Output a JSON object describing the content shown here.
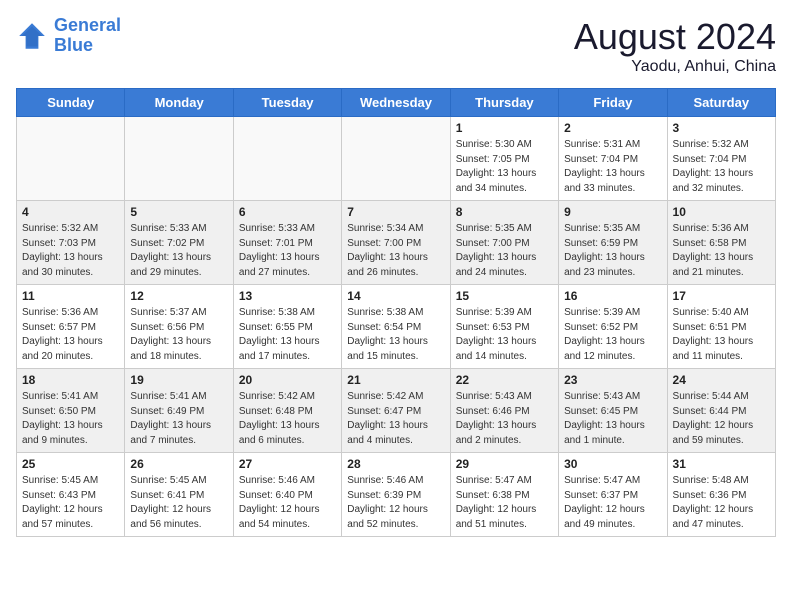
{
  "header": {
    "logo_line1": "General",
    "logo_line2": "Blue",
    "month_year": "August 2024",
    "location": "Yaodu, Anhui, China"
  },
  "weekdays": [
    "Sunday",
    "Monday",
    "Tuesday",
    "Wednesday",
    "Thursday",
    "Friday",
    "Saturday"
  ],
  "rows": [
    {
      "shaded": false,
      "days": [
        {
          "num": "",
          "info": ""
        },
        {
          "num": "",
          "info": ""
        },
        {
          "num": "",
          "info": ""
        },
        {
          "num": "",
          "info": ""
        },
        {
          "num": "1",
          "info": "Sunrise: 5:30 AM\nSunset: 7:05 PM\nDaylight: 13 hours\nand 34 minutes."
        },
        {
          "num": "2",
          "info": "Sunrise: 5:31 AM\nSunset: 7:04 PM\nDaylight: 13 hours\nand 33 minutes."
        },
        {
          "num": "3",
          "info": "Sunrise: 5:32 AM\nSunset: 7:04 PM\nDaylight: 13 hours\nand 32 minutes."
        }
      ]
    },
    {
      "shaded": true,
      "days": [
        {
          "num": "4",
          "info": "Sunrise: 5:32 AM\nSunset: 7:03 PM\nDaylight: 13 hours\nand 30 minutes."
        },
        {
          "num": "5",
          "info": "Sunrise: 5:33 AM\nSunset: 7:02 PM\nDaylight: 13 hours\nand 29 minutes."
        },
        {
          "num": "6",
          "info": "Sunrise: 5:33 AM\nSunset: 7:01 PM\nDaylight: 13 hours\nand 27 minutes."
        },
        {
          "num": "7",
          "info": "Sunrise: 5:34 AM\nSunset: 7:00 PM\nDaylight: 13 hours\nand 26 minutes."
        },
        {
          "num": "8",
          "info": "Sunrise: 5:35 AM\nSunset: 7:00 PM\nDaylight: 13 hours\nand 24 minutes."
        },
        {
          "num": "9",
          "info": "Sunrise: 5:35 AM\nSunset: 6:59 PM\nDaylight: 13 hours\nand 23 minutes."
        },
        {
          "num": "10",
          "info": "Sunrise: 5:36 AM\nSunset: 6:58 PM\nDaylight: 13 hours\nand 21 minutes."
        }
      ]
    },
    {
      "shaded": false,
      "days": [
        {
          "num": "11",
          "info": "Sunrise: 5:36 AM\nSunset: 6:57 PM\nDaylight: 13 hours\nand 20 minutes."
        },
        {
          "num": "12",
          "info": "Sunrise: 5:37 AM\nSunset: 6:56 PM\nDaylight: 13 hours\nand 18 minutes."
        },
        {
          "num": "13",
          "info": "Sunrise: 5:38 AM\nSunset: 6:55 PM\nDaylight: 13 hours\nand 17 minutes."
        },
        {
          "num": "14",
          "info": "Sunrise: 5:38 AM\nSunset: 6:54 PM\nDaylight: 13 hours\nand 15 minutes."
        },
        {
          "num": "15",
          "info": "Sunrise: 5:39 AM\nSunset: 6:53 PM\nDaylight: 13 hours\nand 14 minutes."
        },
        {
          "num": "16",
          "info": "Sunrise: 5:39 AM\nSunset: 6:52 PM\nDaylight: 13 hours\nand 12 minutes."
        },
        {
          "num": "17",
          "info": "Sunrise: 5:40 AM\nSunset: 6:51 PM\nDaylight: 13 hours\nand 11 minutes."
        }
      ]
    },
    {
      "shaded": true,
      "days": [
        {
          "num": "18",
          "info": "Sunrise: 5:41 AM\nSunset: 6:50 PM\nDaylight: 13 hours\nand 9 minutes."
        },
        {
          "num": "19",
          "info": "Sunrise: 5:41 AM\nSunset: 6:49 PM\nDaylight: 13 hours\nand 7 minutes."
        },
        {
          "num": "20",
          "info": "Sunrise: 5:42 AM\nSunset: 6:48 PM\nDaylight: 13 hours\nand 6 minutes."
        },
        {
          "num": "21",
          "info": "Sunrise: 5:42 AM\nSunset: 6:47 PM\nDaylight: 13 hours\nand 4 minutes."
        },
        {
          "num": "22",
          "info": "Sunrise: 5:43 AM\nSunset: 6:46 PM\nDaylight: 13 hours\nand 2 minutes."
        },
        {
          "num": "23",
          "info": "Sunrise: 5:43 AM\nSunset: 6:45 PM\nDaylight: 13 hours\nand 1 minute."
        },
        {
          "num": "24",
          "info": "Sunrise: 5:44 AM\nSunset: 6:44 PM\nDaylight: 12 hours\nand 59 minutes."
        }
      ]
    },
    {
      "shaded": false,
      "days": [
        {
          "num": "25",
          "info": "Sunrise: 5:45 AM\nSunset: 6:43 PM\nDaylight: 12 hours\nand 57 minutes."
        },
        {
          "num": "26",
          "info": "Sunrise: 5:45 AM\nSunset: 6:41 PM\nDaylight: 12 hours\nand 56 minutes."
        },
        {
          "num": "27",
          "info": "Sunrise: 5:46 AM\nSunset: 6:40 PM\nDaylight: 12 hours\nand 54 minutes."
        },
        {
          "num": "28",
          "info": "Sunrise: 5:46 AM\nSunset: 6:39 PM\nDaylight: 12 hours\nand 52 minutes."
        },
        {
          "num": "29",
          "info": "Sunrise: 5:47 AM\nSunset: 6:38 PM\nDaylight: 12 hours\nand 51 minutes."
        },
        {
          "num": "30",
          "info": "Sunrise: 5:47 AM\nSunset: 6:37 PM\nDaylight: 12 hours\nand 49 minutes."
        },
        {
          "num": "31",
          "info": "Sunrise: 5:48 AM\nSunset: 6:36 PM\nDaylight: 12 hours\nand 47 minutes."
        }
      ]
    }
  ]
}
